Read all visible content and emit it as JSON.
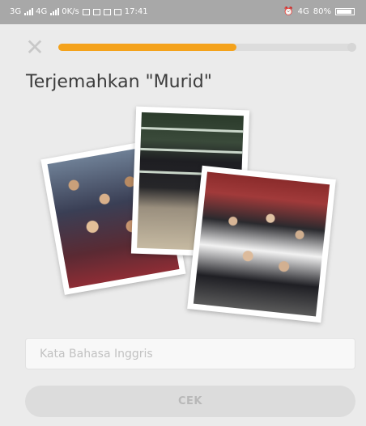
{
  "status_bar": {
    "network_left": "3G",
    "network_mid": "4G",
    "speed": "0K/s",
    "time": "17:41",
    "network_right": "4G",
    "battery": "80%"
  },
  "lesson": {
    "progress": 0.6,
    "title": "Terjemahkan \"Murid\"",
    "images": [
      {
        "icon": "students-in-auditorium-photo"
      },
      {
        "icon": "students-sitting-on-bleachers-photo"
      },
      {
        "icon": "students-in-hall-photo"
      }
    ]
  },
  "answer": {
    "placeholder": "Kata Bahasa Inggris",
    "value": ""
  },
  "check_button": {
    "label": "CEK"
  },
  "colors": {
    "accent": "#f4a21b",
    "background": "#ebebeb",
    "button_disabled": "#dcdcdc"
  }
}
